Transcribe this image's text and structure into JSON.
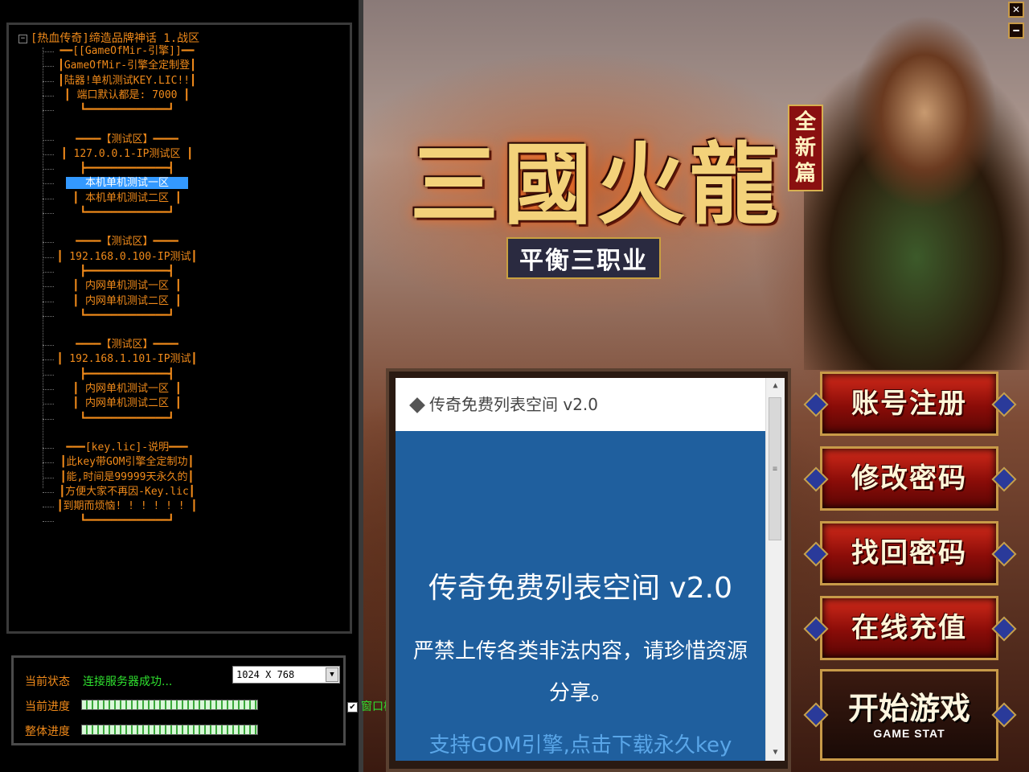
{
  "window": {
    "close_label": "✕",
    "minimize_label": "━"
  },
  "logo": {
    "title": "三國火龍",
    "side": "全新篇",
    "subtitle": "平衡三职业"
  },
  "tree": {
    "root": "[热血传奇]缔造品牌神话 1.战区",
    "nodes": [
      "━━[[GameOfMir-引擎]]━━",
      "┃GameOfMir-引擎全定制登┃",
      "┃陆器!单机测试KEY.LIC!!┃",
      "┃ 端口默认都是: 7000 ┃",
      "┗━━━━━━━━━━━━━┛",
      "━━━━【测试区】━━━━",
      "┃ 127.0.0.1-IP测试区 ┃",
      "┣━━━━━━━━━━━━━┫",
      "本机单机测试一区",
      "┃ 本机单机测试二区 ┃",
      "┗━━━━━━━━━━━━━┛",
      "━━━━【测试区】━━━━",
      "┃ 192.168.0.100-IP测试┃",
      "┣━━━━━━━━━━━━━┫",
      "┃ 内网单机测试一区 ┃",
      "┃ 内网单机测试二区 ┃",
      "┗━━━━━━━━━━━━━┛",
      "━━━━【测试区】━━━━",
      "┃ 192.168.1.101-IP测试┃",
      "┣━━━━━━━━━━━━━┫",
      "┃ 内网单机测试一区 ┃",
      "┃ 内网单机测试二区 ┃",
      "┗━━━━━━━━━━━━━┛",
      "━━━[key.lic]-说明━━━",
      "┃此key带GOM引擎全定制功┃",
      "┃能,时间是99999天永久的┃",
      "┃方便大家不再因-Key.lic┃",
      "┃到期而烦恼! ! ! ! ! ! ┃",
      "┗━━━━━━━━━━━━━┛"
    ],
    "selected_index": 8
  },
  "status": {
    "state_label": "当前状态",
    "state_value": "连接服务器成功...",
    "resolution": "1024 X 768",
    "current_progress_label": "当前进度",
    "total_progress_label": "整体进度",
    "current_progress": 1.0,
    "total_progress": 1.0,
    "window_mode_label": "窗口模",
    "window_mode_checked": "✔"
  },
  "news": {
    "header": "传奇免费列表空间 v2.0",
    "title": "传奇免费列表空间 v2.0",
    "text": "严禁上传各类非法内容，请珍惜资源分享。",
    "link": "支持GOM引擎,点击下载永久key",
    "scroll_up": "▲",
    "scroll_down": "▼",
    "scroll_grip": "≡"
  },
  "menu": {
    "register": "账号注册",
    "change_password": "修改密码",
    "recover_password": "找回密码",
    "recharge": "在线充值",
    "start": "开始游戏",
    "start_sub": "GAME STAT"
  },
  "colors": {
    "accent": "#f08a1a",
    "status_ok": "#2fe02f",
    "selection": "#3399ff",
    "news_bg": "#1f5f9e"
  }
}
